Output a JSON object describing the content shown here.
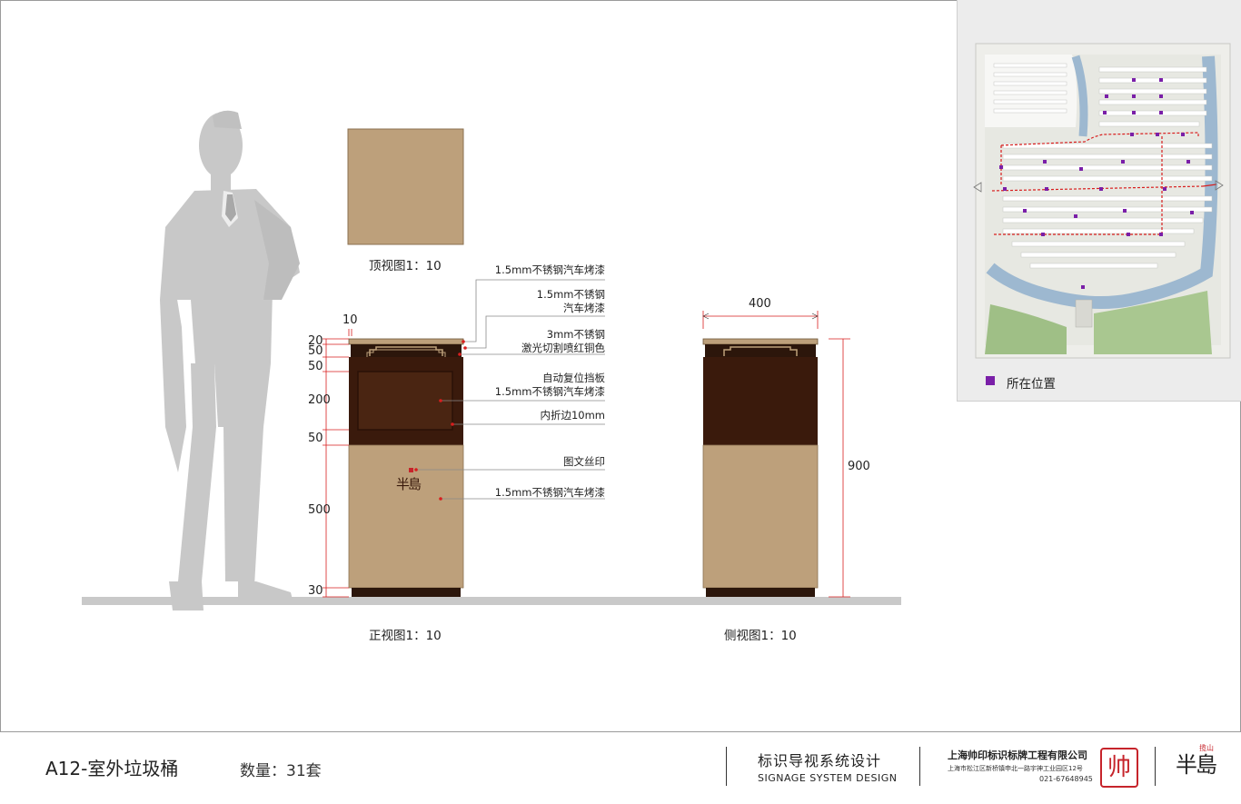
{
  "views": {
    "top_caption": "顶视图1：10",
    "front_caption": "正视图1：10",
    "side_caption": "侧视图1：10"
  },
  "front_dims": {
    "width": "10",
    "heights": [
      "20",
      "50",
      "50",
      "200",
      "50",
      "500",
      "30"
    ]
  },
  "side_dims": {
    "width": "400",
    "height": "900"
  },
  "annotations": [
    "1.5mm不锈钢汽车烤漆",
    "1.5mm不锈钢\n汽车烤漆",
    "3mm不锈钢\n激光切割喷红铜色",
    "自动复位挡板\n1.5mm不锈钢汽车烤漆",
    "内折边10mm",
    "图文丝印",
    "1.5mm不锈钢汽车烤漆"
  ],
  "legend": {
    "label": "所在位置",
    "color": "#7a1fa8"
  },
  "colors": {
    "bin_body": "#bda07b",
    "bin_dark": "#3a1a0c",
    "bin_dark_top": "#2c160b",
    "silhouette": "#c8c8c8",
    "leader": "#d81e1e"
  },
  "footer": {
    "code": "A12-室外垃圾桶",
    "quantity": "数量：31套",
    "system_cn": "标识导视系统设计",
    "system_en": "SIGNAGE SYSTEM DESIGN",
    "company": "上海帅印标识标牌工程有限公司",
    "address": "上海市松江区新桥镇申北一路宇神工业园区12号",
    "phone": "021-67648945",
    "seal_char": "帅",
    "brand_logo": "半島",
    "brand_small": "揽山"
  },
  "bin_logo": "半島"
}
